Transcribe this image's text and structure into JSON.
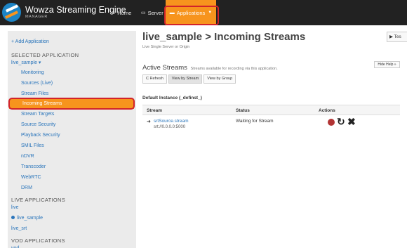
{
  "topbar": {
    "title": "Wowza Streaming Engine",
    "subtitle": "MANAGER",
    "nav": {
      "home": {
        "icon": "home-icon",
        "label": "Home"
      },
      "server": {
        "icon": "monitor-icon",
        "label": "Server"
      },
      "applications": {
        "icon": "folder-icon",
        "label": "Applications"
      }
    }
  },
  "sidebar": {
    "add_application": "+ Add Application",
    "selected_heading": "SELECTED APPLICATION",
    "selected_app": "live_sample ▾",
    "menu": [
      "Monitoring",
      "Sources (Live)",
      "Stream Files",
      "Incoming Streams",
      "Stream Targets",
      "Source Security",
      "Playback Security",
      "SMIL Files",
      "nDVR",
      "Transcoder",
      "WebRTC",
      "DRM"
    ],
    "live_heading": "LIVE APPLICATIONS",
    "live_apps": [
      "live",
      "live_sample",
      "live_srt"
    ],
    "vod_heading": "VOD APPLICATIONS",
    "vod_apps": [
      "vod"
    ]
  },
  "main": {
    "title": "live_sample > Incoming Streams",
    "subtitle": "Live Single Server or Origin",
    "test_button": "▶ Tes",
    "section_title": "Active Streams",
    "section_desc": "Streams available for recording via this application.",
    "hide_help": "Hide Help »",
    "buttons": {
      "refresh": "C Refresh",
      "view_by_stream": "View by Stream",
      "view_by_group": "View by Group"
    },
    "instance_title": "Default Instance (_definst_)",
    "table": {
      "columns": [
        "Stream",
        "Status",
        "Actions"
      ],
      "rows": [
        {
          "stream": "srtSource.stream",
          "url": "srt://0.0.0.0:5000",
          "status": "Waiting for Stream"
        }
      ]
    }
  },
  "colors": {
    "topbar": "#222222",
    "accent_orange": "#f7941d",
    "link_blue": "#2a75bb",
    "highlight_red": "#d2232a",
    "record_red": "#b23434"
  }
}
